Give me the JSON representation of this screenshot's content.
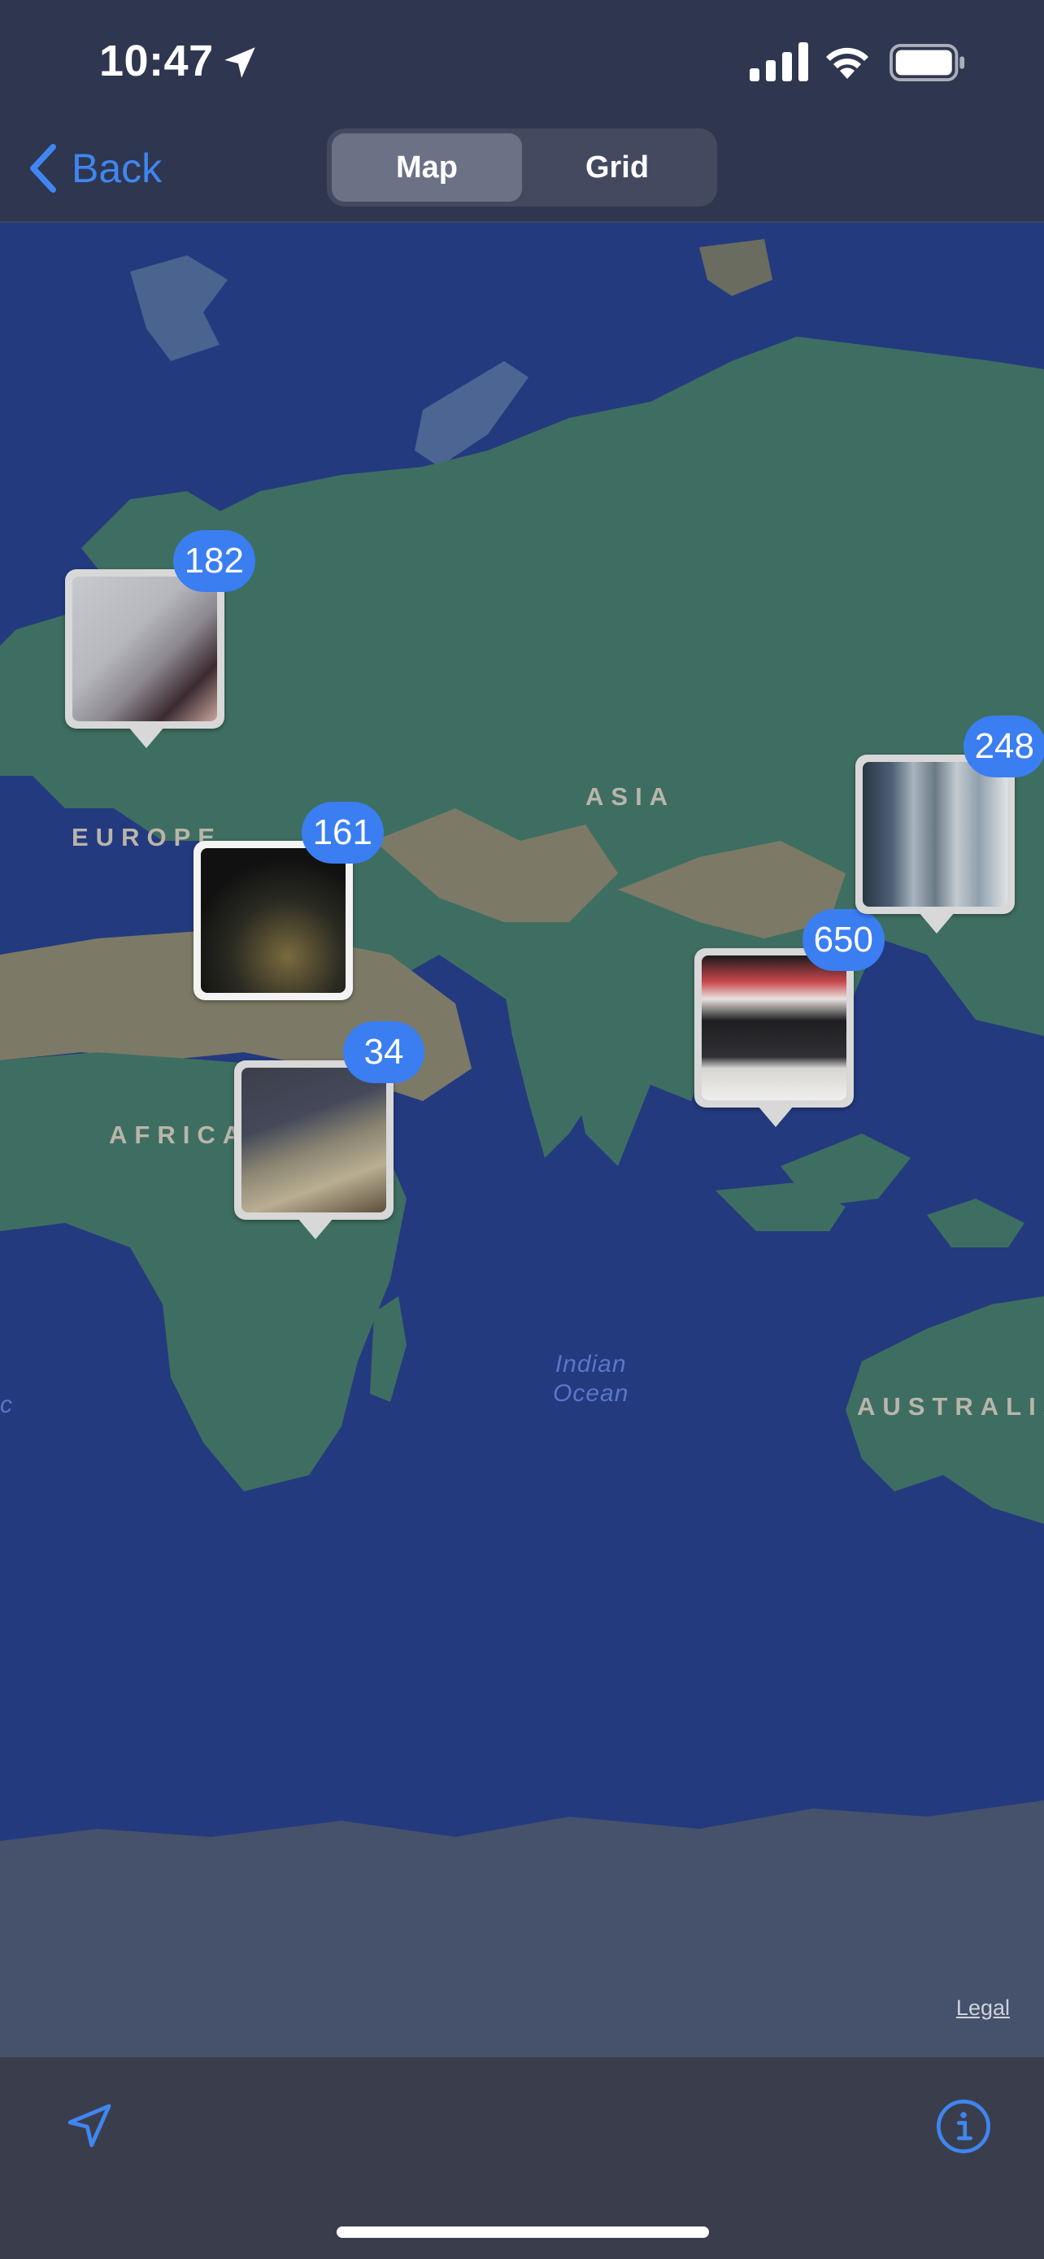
{
  "status_bar": {
    "time": "10:47"
  },
  "nav": {
    "back_label": "Back",
    "tabs": [
      {
        "label": "Map",
        "selected": true
      },
      {
        "label": "Grid",
        "selected": false
      }
    ]
  },
  "map": {
    "regions": [
      "EUROPE",
      "ASIA",
      "AFRICA",
      "AUSTRALIA"
    ],
    "ocean_label_line1": "Indian",
    "ocean_label_line2": "Ocean",
    "left_edge_fragment": "c",
    "legal_link": "Legal",
    "clusters": [
      {
        "count": "182",
        "place": "Europe (north)"
      },
      {
        "count": "161",
        "place": "Europe (south)"
      },
      {
        "count": "34",
        "place": "Africa (east)"
      },
      {
        "count": "650",
        "place": "Southeast Asia"
      },
      {
        "count": "248",
        "place": "East Asia"
      }
    ]
  },
  "colors": {
    "accent": "#3b7ef2",
    "ocean": "#243a7f",
    "land_green": "#3e6e61",
    "land_tan": "#7c7a66",
    "ice": "#3f4c6b",
    "bars": "#2f3650"
  },
  "icons": {
    "location_services": "location-arrow-icon",
    "signal": "cellular-signal-icon",
    "wifi": "wifi-icon",
    "battery": "battery-icon",
    "back": "chevron-left-icon",
    "track": "location-arrow-outline-icon",
    "info": "info-circle-icon"
  }
}
